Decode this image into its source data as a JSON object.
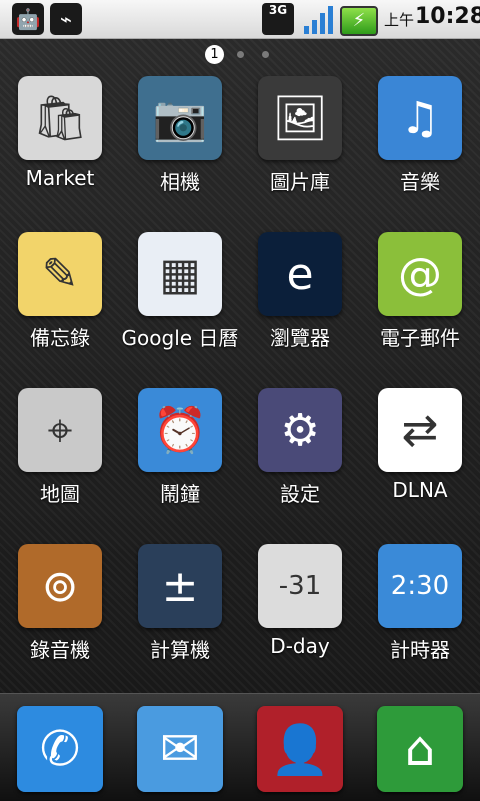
{
  "status_bar": {
    "ampm": "上午",
    "time": "10:28",
    "network": "3G",
    "icons": [
      "android-debug-icon",
      "usb-icon",
      "3g-icon",
      "signal-icon",
      "battery-charging-icon"
    ]
  },
  "page_indicator": {
    "active": "1",
    "count": 3
  },
  "apps": [
    {
      "label": "Market",
      "icon": "market-bag-icon",
      "color": "#d8d8d8"
    },
    {
      "label": "相機",
      "icon": "camera-icon",
      "color": "#3f6f8f"
    },
    {
      "label": "圖片庫",
      "icon": "gallery-icon",
      "color": "#3a3a3a"
    },
    {
      "label": "音樂",
      "icon": "music-icon",
      "color": "#3a86d6"
    },
    {
      "label": "備忘錄",
      "icon": "memo-icon",
      "color": "#f2d46a"
    },
    {
      "label": "Google 日曆",
      "icon": "calendar-icon",
      "color": "#e9eef5"
    },
    {
      "label": "瀏覽器",
      "icon": "browser-globe-icon",
      "color": "#0b1f3a"
    },
    {
      "label": "電子郵件",
      "icon": "email-icon",
      "color": "#8bbf3a"
    },
    {
      "label": "地圖",
      "icon": "maps-icon",
      "color": "#c9c9c9"
    },
    {
      "label": "鬧鐘",
      "icon": "alarm-clock-icon",
      "color": "#3a8ad8"
    },
    {
      "label": "設定",
      "icon": "settings-gear-icon",
      "color": "#4a4a78"
    },
    {
      "label": "DLNA",
      "icon": "dlna-icon",
      "color": "#ffffff"
    },
    {
      "label": "錄音機",
      "icon": "voice-recorder-icon",
      "color": "#b06a2a"
    },
    {
      "label": "計算機",
      "icon": "calculator-icon",
      "color": "#2a3f5a"
    },
    {
      "label": "D-day",
      "icon": "dday-counter-icon",
      "color": "#dcdcdc"
    },
    {
      "label": "計時器",
      "icon": "timer-icon",
      "color": "#3a8ad8"
    }
  ],
  "icon_glyphs": {
    "app0": "🛍",
    "app1": "📷",
    "app2": "🖼",
    "app3": "♫",
    "app4": "✎",
    "app5": "▦",
    "app6": "e",
    "app7": "@",
    "app8": "⌖",
    "app9": "⏰",
    "app10": "⚙",
    "app11": "⇄",
    "app12": "⊚",
    "app13": "±",
    "app14": "-31",
    "app15": "2:30"
  },
  "dock": [
    {
      "name": "phone-icon",
      "glyph": "✆",
      "color": "#2d8be0"
    },
    {
      "name": "messaging-icon",
      "glyph": "✉",
      "color": "#4a9be0"
    },
    {
      "name": "contacts-icon",
      "glyph": "👤",
      "color": "#b0202a"
    },
    {
      "name": "home-icon",
      "glyph": "⌂",
      "color": "#2e9b3a"
    }
  ]
}
